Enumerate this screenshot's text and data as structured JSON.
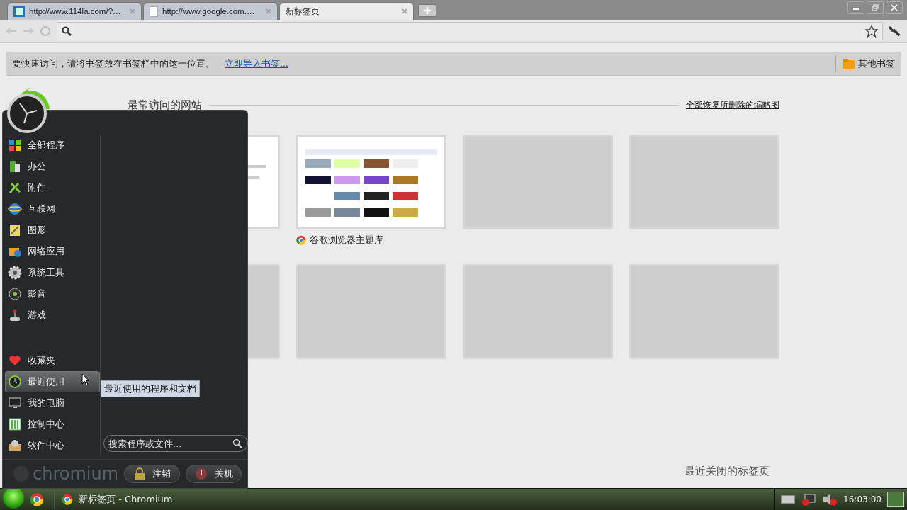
{
  "tabs": [
    {
      "title": "http://www.114la.com/?…",
      "selected": false
    },
    {
      "title": "http://www.google.com.…",
      "selected": false
    },
    {
      "title": "新标签页",
      "selected": true
    }
  ],
  "bookmark_bar": {
    "message": "要快速访问，请将书签放在书签栏中的这一位置。",
    "import_link": "立即导入书签...",
    "other_bookmarks": "其他书签"
  },
  "most_visited": {
    "title": "最常访问的网站",
    "restore_link": "全部恢复所删除的缩略图",
    "thumbnails": [
      {
        "kind": "picture"
      },
      {
        "kind": "picture",
        "title": "谷歌浏览器主题库"
      },
      {
        "kind": "empty"
      },
      {
        "kind": "empty"
      },
      {
        "kind": "empty"
      },
      {
        "kind": "empty"
      },
      {
        "kind": "empty"
      },
      {
        "kind": "empty"
      }
    ]
  },
  "recently_closed": "最近关闭的标签页",
  "start_menu": {
    "programs": [
      {
        "label": "全部程序",
        "selected": false
      },
      {
        "label": "办公",
        "selected": false
      },
      {
        "label": "附件",
        "selected": false
      },
      {
        "label": "互联网",
        "selected": false
      },
      {
        "label": "图形",
        "selected": false
      },
      {
        "label": "网络应用",
        "selected": false
      },
      {
        "label": "系统工具",
        "selected": false
      },
      {
        "label": "影音",
        "selected": false
      },
      {
        "label": "游戏",
        "selected": false
      }
    ],
    "places": [
      {
        "label": "收藏夹",
        "selected": false
      },
      {
        "label": "最近使用",
        "selected": true
      },
      {
        "label": "我的电脑",
        "selected": false
      },
      {
        "label": "控制中心",
        "selected": false
      },
      {
        "label": "软件中心",
        "selected": false
      }
    ],
    "tooltip": "最近使用的程序和文档",
    "search": {
      "placeholder": "搜索程序或文件..."
    },
    "brand": "chromium",
    "buttons": [
      "注销",
      "关机"
    ]
  },
  "taskbar": {
    "tasks": [
      {
        "label": "新标签页 - Chromium"
      }
    ],
    "clock": "16:03:00"
  }
}
